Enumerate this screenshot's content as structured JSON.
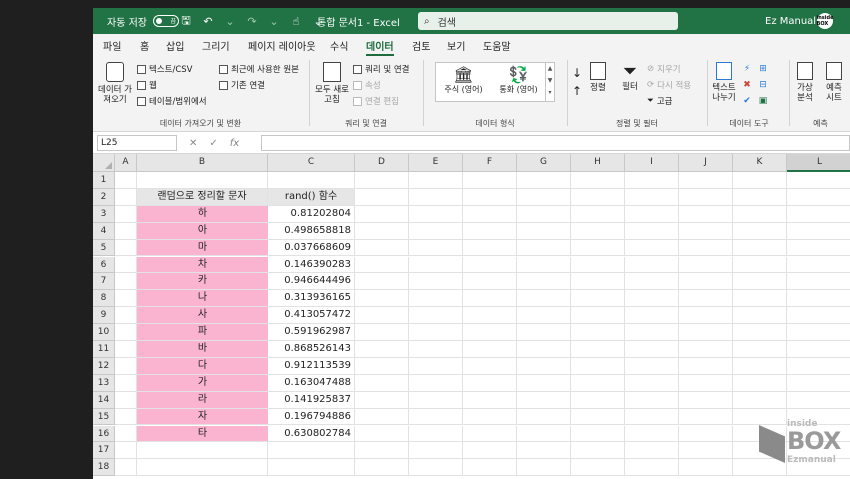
{
  "titlebar": {
    "autosave_label": "자동 저장",
    "autosave_state": "끔",
    "doc_title": "통합 문서1 - Excel",
    "search_placeholder": "검색",
    "user_name": "Ez Manual",
    "avatar_text": "inside BOX"
  },
  "menu": [
    "파일",
    "홈",
    "삽입",
    "그리기",
    "페이지 레이아웃",
    "수식",
    "데이터",
    "검토",
    "보기",
    "도움말"
  ],
  "active_menu": "데이터",
  "ribbon": {
    "get_data_label": "데이터 가\n져오기",
    "text_csv": "텍스트/CSV",
    "web": "웹",
    "table_range": "테이블/범위에서",
    "recent_sources": "최근에 사용한 원본",
    "existing_connections": "기존 연결",
    "group_get_transform": "데이터 가져오기 및 변환",
    "refresh_all": "모두 새로\n고침",
    "queries_connections": "쿼리 및 연결",
    "properties": "속성",
    "edit_links": "연결 편집",
    "group_queries": "쿼리 및 연결",
    "stocks": "주식 (영어)",
    "currency": "통화 (영어)",
    "group_data_types": "데이터 형식",
    "sort": "정렬",
    "filter": "필터",
    "clear": "지우기",
    "reapply": "다시 적용",
    "advanced": "고급",
    "group_sort_filter": "정렬 및 필터",
    "text_to_columns": "텍스트\n나누기",
    "group_data_tools": "데이터 도구",
    "what_if": "가상\n분석",
    "forecast_sheet": "예측\n시트",
    "group_forecast": "예측"
  },
  "formula_bar": {
    "name_box": "L25",
    "cancel": "✕",
    "enter": "✓",
    "fx": "fx",
    "formula": ""
  },
  "columns": [
    "A",
    "B",
    "C",
    "D",
    "E",
    "F",
    "G",
    "H",
    "I",
    "J",
    "K",
    "L"
  ],
  "rows": [
    "1",
    "2",
    "3",
    "4",
    "5",
    "6",
    "7",
    "8",
    "9",
    "10",
    "11",
    "12",
    "13",
    "14",
    "15",
    "16",
    "17",
    "18"
  ],
  "table": {
    "header_b": "랜덤으로 정리할 문자",
    "header_c": "rand() 함수",
    "letters": [
      "하",
      "아",
      "마",
      "차",
      "카",
      "나",
      "사",
      "파",
      "바",
      "다",
      "가",
      "라",
      "자",
      "타"
    ],
    "rand_values": [
      "0.81202804",
      "0.498658818",
      "0.037668609",
      "0.146390283",
      "0.946644496",
      "0.313936165",
      "0.413057472",
      "0.591962987",
      "0.868526143",
      "0.912113539",
      "0.163047488",
      "0.141925837",
      "0.196794886",
      "0.630802784"
    ]
  },
  "watermark": {
    "line1": "inside",
    "line2": "BOX",
    "line3": "Ezmanual"
  },
  "colors": {
    "excel_green": "#217346",
    "pink_fill": "#fbb4cf"
  }
}
